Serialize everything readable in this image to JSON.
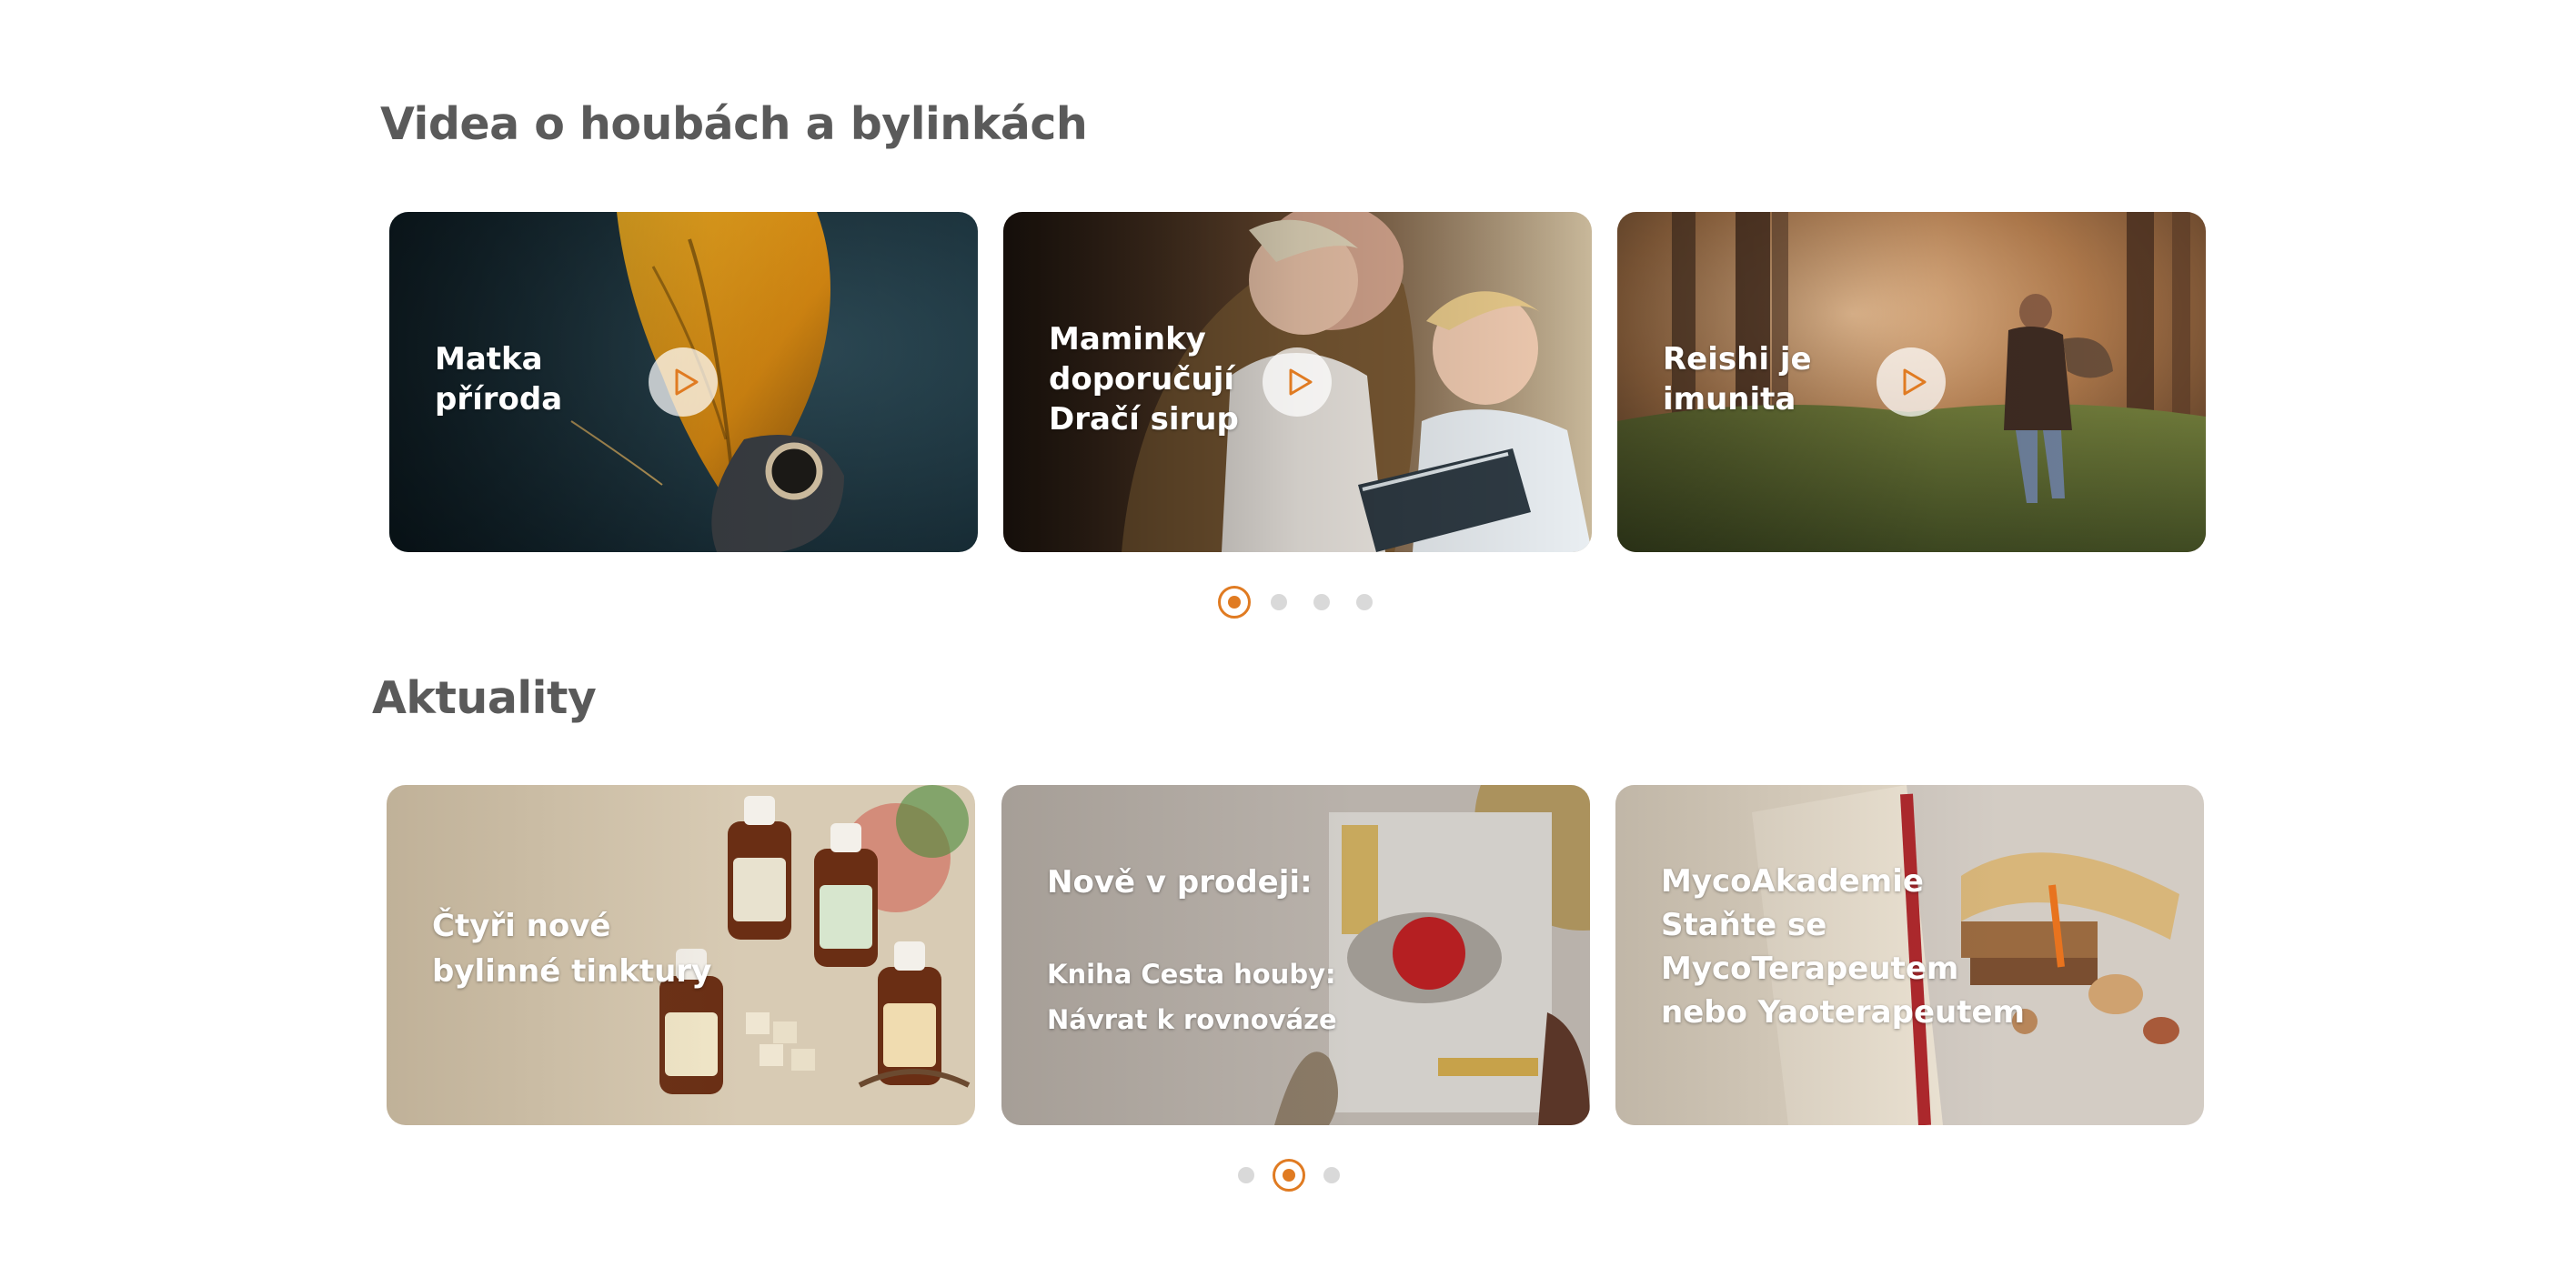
{
  "videos": {
    "title": "Videa o houbách a bylinkách",
    "cards": [
      {
        "title": "Matka\npříroda",
        "icon": "play-icon"
      },
      {
        "title": "Maminky\ndoporučují\nDračí sirup",
        "icon": "play-icon"
      },
      {
        "title": "Reishi je\nimunita",
        "icon": "play-icon"
      }
    ],
    "pagination": {
      "count": 4,
      "active": 1
    }
  },
  "news": {
    "title": "Aktuality",
    "cards": [
      {
        "title": "Čtyři nové\nbylinné tinktury"
      },
      {
        "title": "Nově v prodeji:",
        "subtitle": "Kniha Cesta houby:\nNávrat k rovnováze"
      },
      {
        "title": "MycoAkademie\nStaňte se\nMycoTerapeutem\nnebo Yaoterapeutem"
      }
    ],
    "pagination": {
      "count": 3,
      "active": 2
    }
  },
  "colors": {
    "accent": "#e07b22",
    "heading": "#5a5a5a",
    "dot": "#d9d9d9"
  }
}
